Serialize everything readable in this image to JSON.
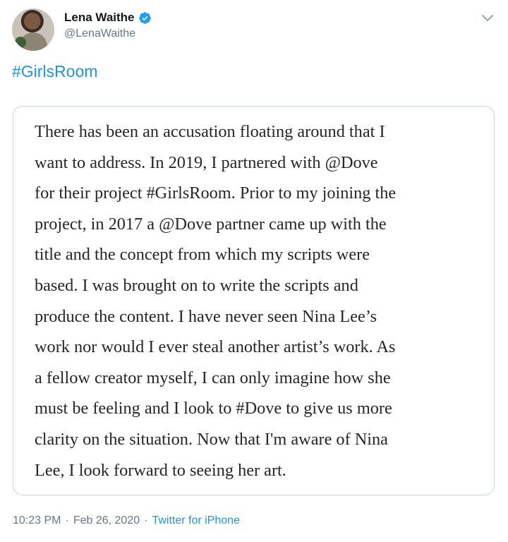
{
  "author": {
    "display_name": "Lena Waithe",
    "handle": "@LenaWaithe"
  },
  "tweet": {
    "hashtag": "#GirlsRoom",
    "statement_lines": [
      "There has been an accusation floating around that I",
      "want to address. In 2019, I partnered with @Dove",
      "for their project #GirlsRoom. Prior to my joining the",
      "project, in 2017 a @Dove partner came up with the",
      "title and the concept from which my scripts were",
      "based. I was brought on to write the scripts and",
      "produce the content. I have never seen Nina Lee’s",
      "work nor would I ever steal another artist’s work. As",
      "a fellow creator myself, I can only imagine how she",
      "must be feeling and I look to #Dove to give us more",
      "clarity on the situation. Now that I'm aware of Nina",
      "Lee, I look forward to seeing her art."
    ]
  },
  "meta": {
    "time": "10:23 PM",
    "separator": "·",
    "date": "Feb 26, 2020",
    "source": "Twitter for iPhone"
  },
  "icons": {
    "verified": "verified-badge-icon",
    "menu": "chevron-down-icon"
  },
  "colors": {
    "link": "#1b95e0",
    "secondary_text": "#657786",
    "verified": "#1da1f2",
    "card_border": "#ccd6dd"
  }
}
